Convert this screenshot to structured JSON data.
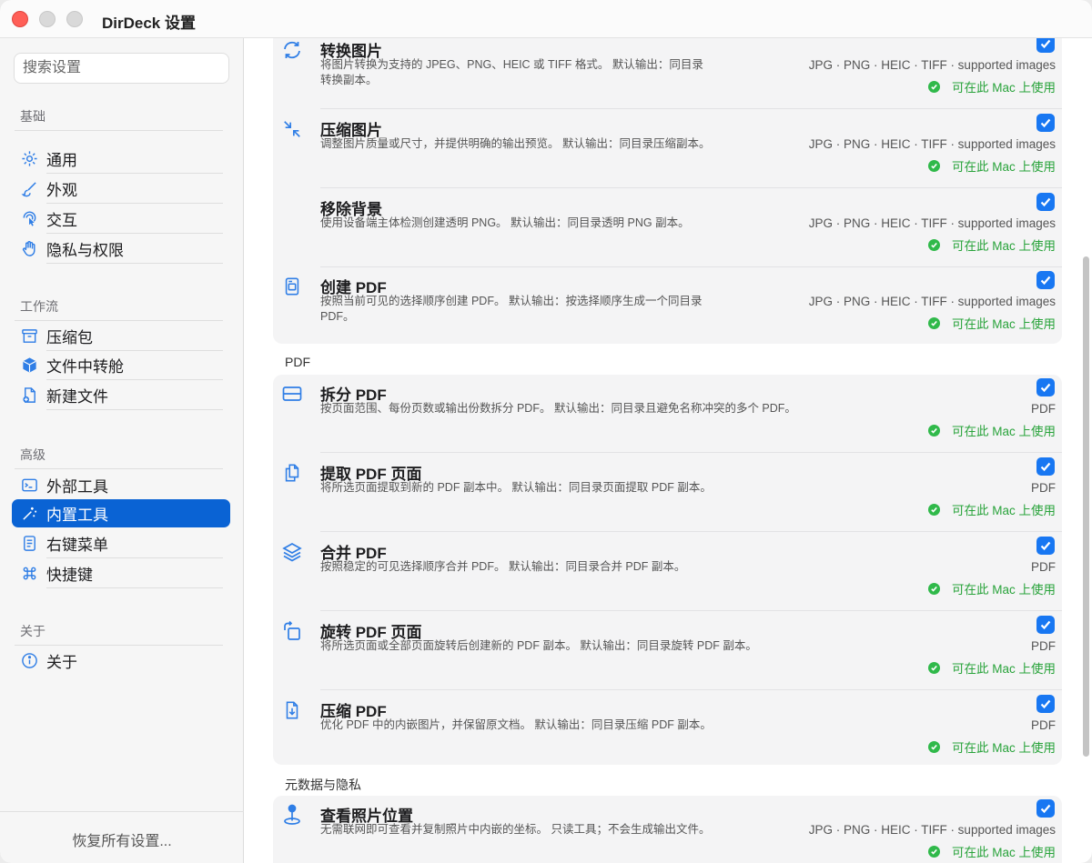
{
  "window": {
    "title": "DirDeck 设置"
  },
  "sidebar": {
    "search_placeholder": "搜索设置",
    "sections": [
      {
        "title": "基础",
        "items": [
          {
            "label": "通用",
            "icon": "gear-icon"
          },
          {
            "label": "外观",
            "icon": "paintbrush-icon"
          },
          {
            "label": "交互",
            "icon": "touch-icon"
          },
          {
            "label": "隐私与权限",
            "icon": "hand-icon"
          }
        ]
      },
      {
        "title": "工作流",
        "items": [
          {
            "label": "压缩包",
            "icon": "archivebox-icon"
          },
          {
            "label": "文件中转舱",
            "icon": "cube-icon"
          },
          {
            "label": "新建文件",
            "icon": "new-file-icon"
          }
        ]
      },
      {
        "title": "高级",
        "items": [
          {
            "label": "外部工具",
            "icon": "terminal-icon"
          },
          {
            "label": "内置工具",
            "icon": "wand-icon",
            "active": true
          },
          {
            "label": "右键菜单",
            "icon": "menu-doc-icon"
          },
          {
            "label": "快捷键",
            "icon": "command-icon"
          }
        ]
      },
      {
        "title": "关于",
        "items": [
          {
            "label": "关于",
            "icon": "info-icon"
          }
        ]
      }
    ],
    "restore_label": "恢复所有设置..."
  },
  "content": {
    "groups": [
      {
        "label": "",
        "rows": [
          {
            "title": "转换图片",
            "desc": "将图片转换为支持的 JPEG、PNG、HEIC 或 TIFF 格式。 默认输出：同目录转换副本。",
            "formats": "JPG · PNG · HEIC · TIFF · supported images",
            "status": "可在此 Mac 上使用",
            "checked": true,
            "icon": "convert-arrows-icon"
          },
          {
            "title": "压缩图片",
            "desc": "调整图片质量或尺寸，并提供明确的输出预览。 默认输出：同目录压缩副本。",
            "formats": "JPG · PNG · HEIC · TIFF · supported images",
            "status": "可在此 Mac 上使用",
            "checked": true,
            "icon": "compress-arrows-icon"
          },
          {
            "title": "移除背景",
            "desc": "使用设备端主体检测创建透明 PNG。 默认输出：同目录透明 PNG 副本。",
            "formats": "JPG · PNG · HEIC · TIFF · supported images",
            "status": "可在此 Mac 上使用",
            "checked": true,
            "icon": ""
          },
          {
            "title": "创建 PDF",
            "desc": "按照当前可见的选择顺序创建 PDF。 默认输出：按选择顺序生成一个同目录 PDF。",
            "formats": "JPG · PNG · HEIC · TIFF · supported images",
            "status": "可在此 Mac 上使用",
            "checked": true,
            "icon": "create-pdf-icon"
          }
        ]
      },
      {
        "label": "PDF",
        "rows": [
          {
            "title": "拆分 PDF",
            "desc": "按页面范围、每份页数或输出份数拆分 PDF。 默认输出：同目录且避免名称冲突的多个 PDF。",
            "formats": "PDF",
            "status": "可在此 Mac 上使用",
            "checked": true,
            "icon": "split-pdf-icon"
          },
          {
            "title": "提取 PDF 页面",
            "desc": "将所选页面提取到新的 PDF 副本中。 默认输出：同目录页面提取 PDF 副本。",
            "formats": "PDF",
            "status": "可在此 Mac 上使用",
            "checked": true,
            "icon": "extract-pages-icon"
          },
          {
            "title": "合并 PDF",
            "desc": "按照稳定的可见选择顺序合并 PDF。 默认输出：同目录合并 PDF 副本。",
            "formats": "PDF",
            "status": "可在此 Mac 上使用",
            "checked": true,
            "icon": "layers-icon"
          },
          {
            "title": "旋转 PDF 页面",
            "desc": "将所选页面或全部页面旋转后创建新的 PDF 副本。 默认输出：同目录旋转 PDF 副本。",
            "formats": "PDF",
            "status": "可在此 Mac 上使用",
            "checked": true,
            "icon": "rotate-icon"
          },
          {
            "title": "压缩 PDF",
            "desc": "优化 PDF 中的内嵌图片，并保留原文档。 默认输出：同目录压缩 PDF 副本。",
            "formats": "PDF",
            "status": "可在此 Mac 上使用",
            "checked": true,
            "icon": "download-doc-icon"
          }
        ]
      },
      {
        "label": "元数据与隐私",
        "rows": [
          {
            "title": "查看照片位置",
            "desc": "无需联网即可查看并复制照片中内嵌的坐标。 只读工具；不会生成输出文件。",
            "formats": "JPG · PNG · HEIC · TIFF · supported images",
            "status": "可在此 Mac 上使用",
            "checked": true,
            "icon": "location-pin-icon"
          }
        ]
      }
    ]
  },
  "colors": {
    "accent": "#1877f2",
    "selection": "#0a63d4",
    "status_green": "#29a33b"
  }
}
